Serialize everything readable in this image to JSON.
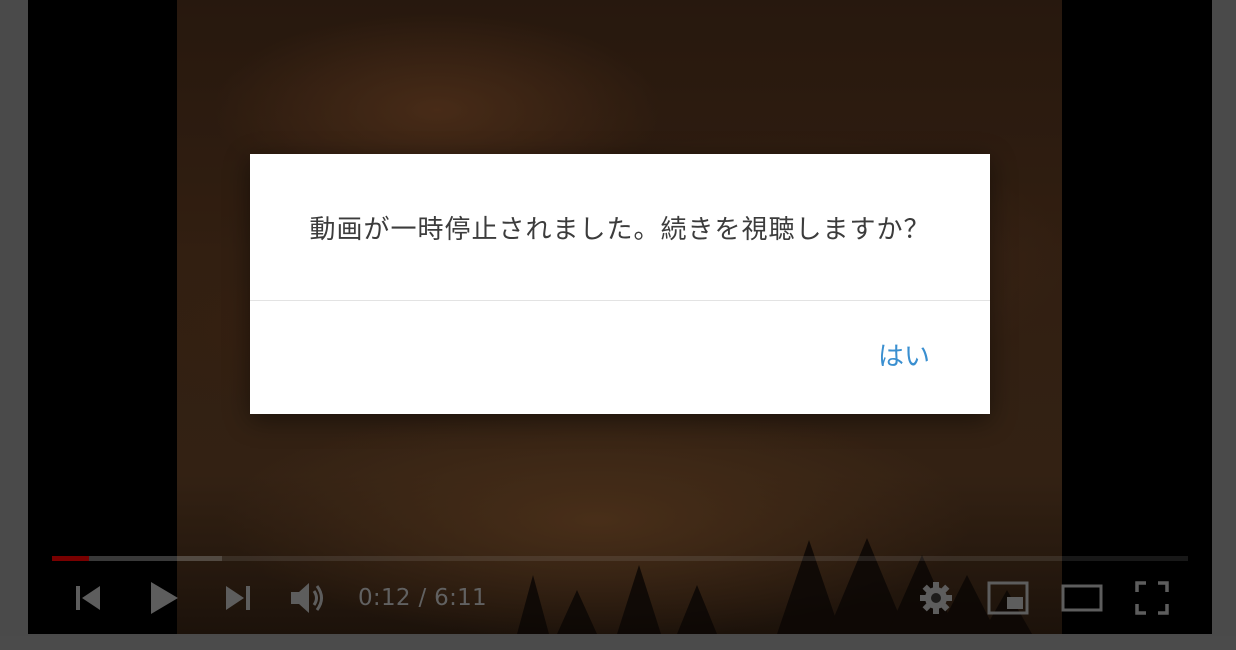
{
  "player": {
    "time_current": "0:12",
    "time_separator": " / ",
    "time_total": "6:11",
    "progress_played": 0.033,
    "progress_loaded": 0.15,
    "played_color": "#b30000"
  },
  "controls": {
    "icons": [
      "previous-icon",
      "play-icon",
      "next-icon",
      "volume-icon",
      "gear-icon",
      "miniplayer-icon",
      "theater-mode-icon",
      "fullscreen-icon"
    ]
  },
  "dialog": {
    "message": "動画が一時停止されました。続きを視聴しますか？",
    "confirm_label": "はい",
    "accent_color": "#3a8fd0"
  }
}
